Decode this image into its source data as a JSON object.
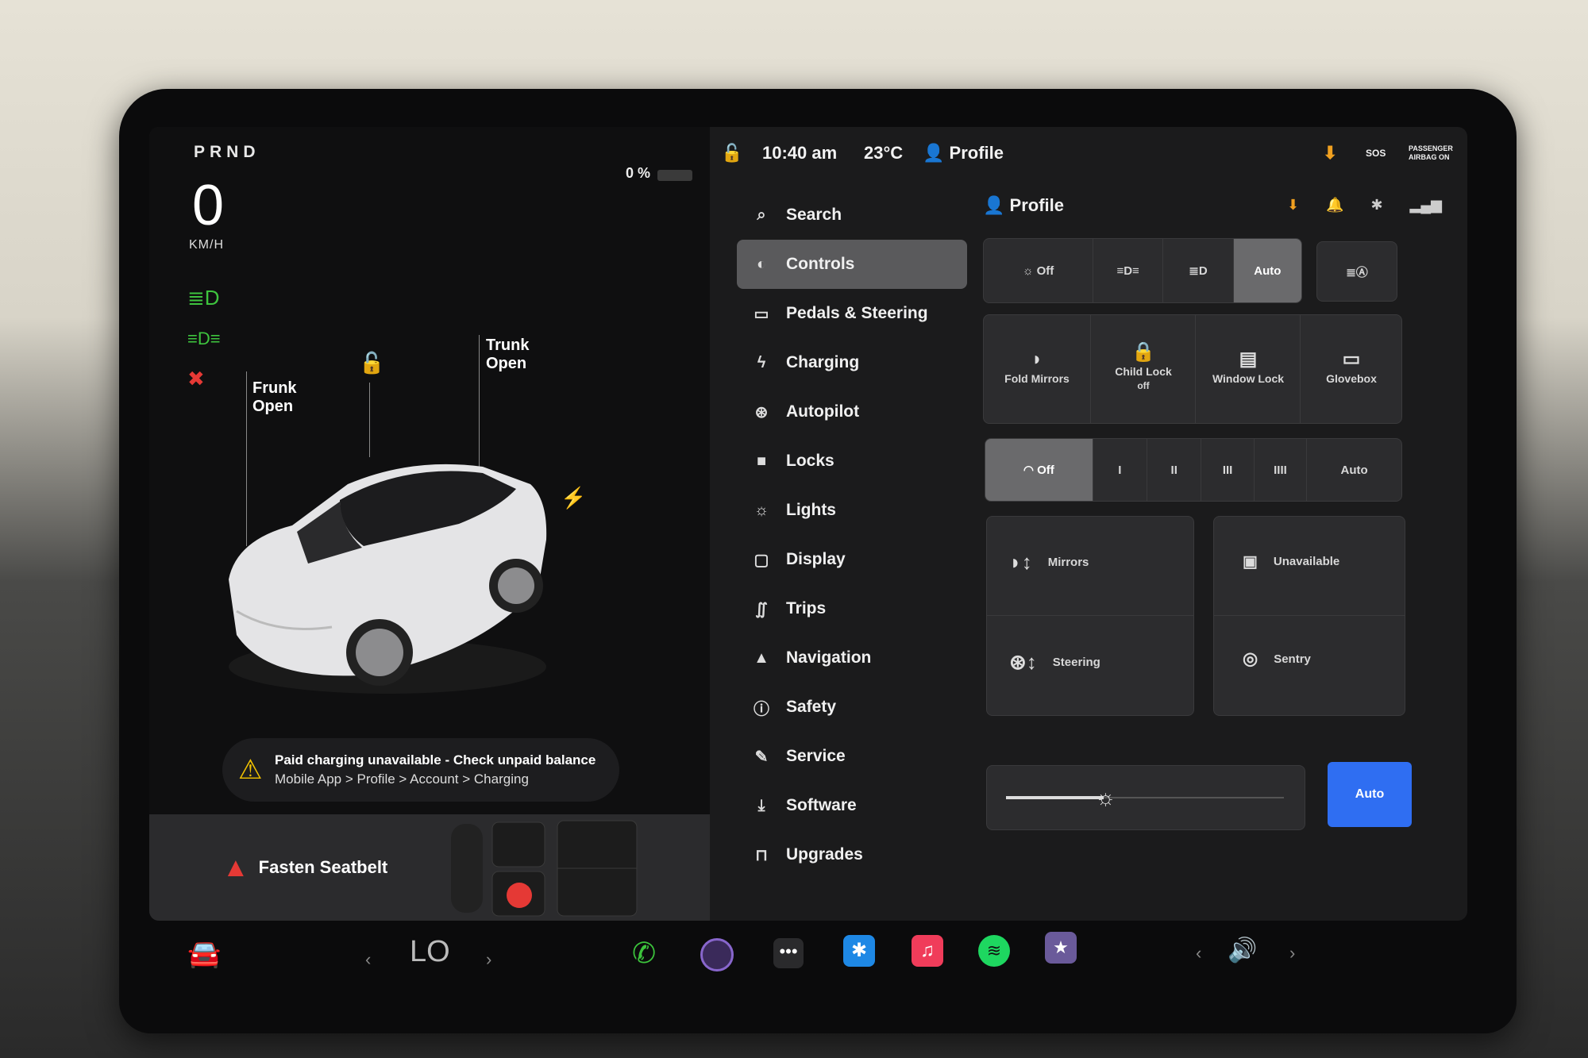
{
  "drive": {
    "gears": "PRND",
    "speed": "0",
    "unit": "KM/H",
    "battery": "0 %"
  },
  "car": {
    "frunk_label": "Frunk",
    "frunk_state": "Open",
    "trunk_label": "Trunk",
    "trunk_state": "Open"
  },
  "alert": {
    "title": "Paid charging unavailable - Check unpaid balance",
    "path": "Mobile App > Profile > Account > Charging"
  },
  "seatbelt": {
    "text": "Fasten Seatbelt"
  },
  "status": {
    "time": "10:40 am",
    "temp": "23°C",
    "profile": "Profile",
    "sos": "SOS",
    "airbag": "PASSENGER AIRBAG ON"
  },
  "menu": {
    "items": [
      {
        "label": "Search",
        "icon": "search-icon"
      },
      {
        "label": "Controls",
        "icon": "toggle-icon"
      },
      {
        "label": "Pedals & Steering",
        "icon": "car-icon"
      },
      {
        "label": "Charging",
        "icon": "bolt-icon"
      },
      {
        "label": "Autopilot",
        "icon": "steering-wheel-icon"
      },
      {
        "label": "Locks",
        "icon": "lock-icon"
      },
      {
        "label": "Lights",
        "icon": "sun-icon"
      },
      {
        "label": "Display",
        "icon": "display-icon"
      },
      {
        "label": "Trips",
        "icon": "trips-icon"
      },
      {
        "label": "Navigation",
        "icon": "navigation-icon"
      },
      {
        "label": "Safety",
        "icon": "safety-icon"
      },
      {
        "label": "Service",
        "icon": "wrench-icon"
      },
      {
        "label": "Software",
        "icon": "download-icon"
      },
      {
        "label": "Upgrades",
        "icon": "bag-icon"
      }
    ]
  },
  "controls": {
    "title": "Profile",
    "lights": {
      "off": "Off",
      "auto": "Auto"
    },
    "tiles": {
      "fold_mirrors": "Fold Mirrors",
      "child_lock": "Child Lock",
      "child_lock_state": "off",
      "window_lock": "Window Lock",
      "glovebox": "Glovebox"
    },
    "wipers": {
      "off": "Off",
      "s1": "I",
      "s2": "II",
      "s3": "III",
      "s4": "IIII",
      "auto": "Auto"
    },
    "mirrors": "Mirrors",
    "steering": "Steering",
    "unavailable": "Unavailable",
    "sentry": "Sentry",
    "brightness_auto": "Auto",
    "brightness_level": 0.35
  },
  "dock": {
    "climate": "LO"
  }
}
